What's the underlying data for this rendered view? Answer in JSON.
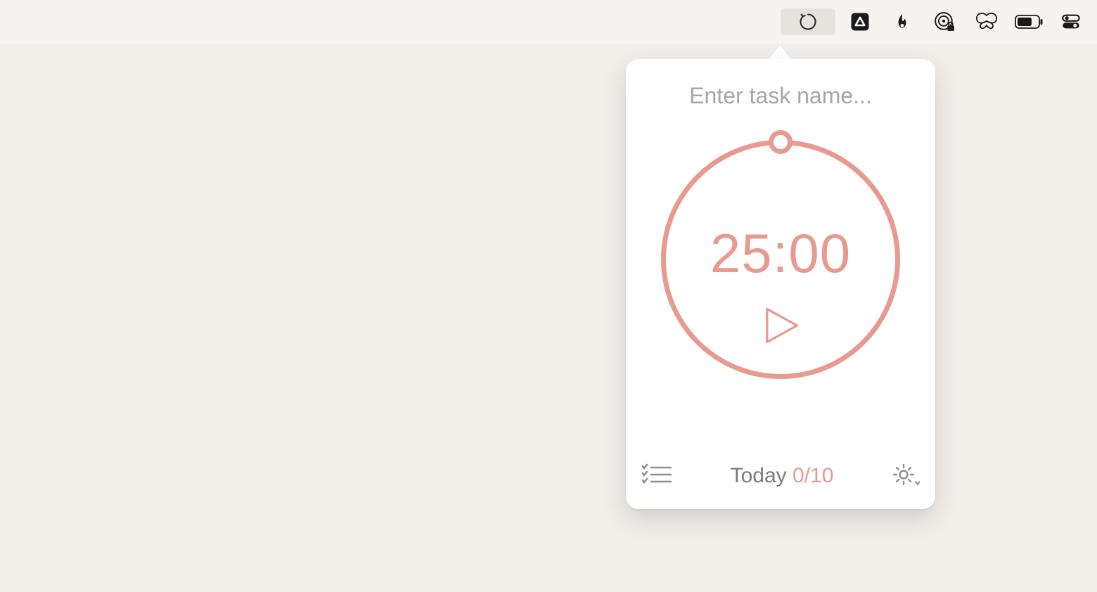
{
  "menubar": {
    "items": [
      {
        "name": "pomodoro-timer-icon",
        "selected": true
      },
      {
        "name": "triangle-app-icon"
      },
      {
        "name": "flame-icon"
      },
      {
        "name": "radar-lock-icon"
      },
      {
        "name": "butterfly-icon"
      },
      {
        "name": "battery-icon"
      },
      {
        "name": "control-center-icon"
      }
    ]
  },
  "timer": {
    "task_input_placeholder": "Enter task name...",
    "task_input_value": "",
    "time_display": "25:00",
    "accent_color": "#e89a91"
  },
  "footer": {
    "today_label": "Today",
    "today_count": "0/10"
  }
}
